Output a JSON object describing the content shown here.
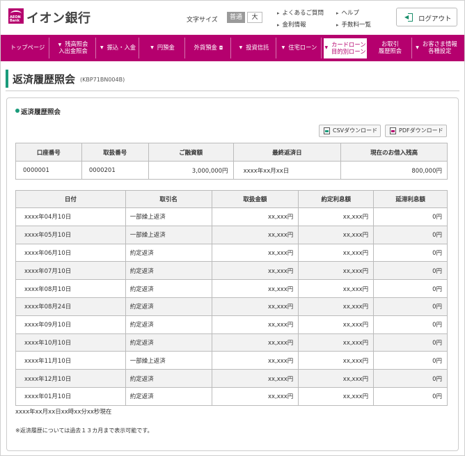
{
  "header": {
    "bank_name": "イオン銀行",
    "logo_small": "AEON Bank",
    "font_size_label": "文字サイズ",
    "font_size_normal": "普通",
    "font_size_large": "大",
    "links": [
      "よくあるご質問",
      "ヘルプ",
      "金利情報",
      "手数料一覧"
    ],
    "logout_label": "ログアウト"
  },
  "nav": {
    "items": [
      {
        "label1": "トップページ",
        "label2": ""
      },
      {
        "label1": "残高照会",
        "label2": "入出金照会"
      },
      {
        "label1": "振込・入金",
        "label2": ""
      },
      {
        "label1": "円預金",
        "label2": ""
      },
      {
        "label1": "外貨預金",
        "label2": ""
      },
      {
        "label1": "投資信託",
        "label2": ""
      },
      {
        "label1": "住宅ローン",
        "label2": ""
      },
      {
        "label1": "カードローン",
        "label2": "目的別ローン"
      },
      {
        "label1": "お取引",
        "label2": "履歴照会"
      },
      {
        "label1": "お客さま情報",
        "label2": "各種設定"
      }
    ],
    "active_index": 7
  },
  "page": {
    "title": "返済履歴照会",
    "code": "(KBP71BN004B)",
    "section_title": "返済履歴照会",
    "csv_button": "CSVダウンロード",
    "pdf_button": "PDFダウンロード"
  },
  "summary": {
    "headers": [
      "口座番号",
      "取扱番号",
      "ご融資額",
      "最終返済日",
      "現在のお借入残高"
    ],
    "row": [
      "0000001",
      "0000201",
      "3,000,000円",
      "xxxx年xx月xx日",
      "800,000円"
    ]
  },
  "history": {
    "headers": [
      "日付",
      "取引名",
      "取扱金額",
      "約定利息額",
      "延滞利息額"
    ],
    "rows": [
      [
        "xxxx年04月10日",
        "一部繰上返済",
        "xx,xxx円",
        "xx,xxx円",
        "0円"
      ],
      [
        "xxxx年05月10日",
        "一部繰上返済",
        "xx,xxx円",
        "xx,xxx円",
        "0円"
      ],
      [
        "xxxx年06月10日",
        "約定返済",
        "xx,xxx円",
        "xx,xxx円",
        "0円"
      ],
      [
        "xxxx年07月10日",
        "約定返済",
        "xx,xxx円",
        "xx,xxx円",
        "0円"
      ],
      [
        "xxxx年08月10日",
        "約定返済",
        "xx,xxx円",
        "xx,xxx円",
        "0円"
      ],
      [
        "xxxx年08月24日",
        "約定返済",
        "xx,xxx円",
        "xx,xxx円",
        "0円"
      ],
      [
        "xxxx年09月10日",
        "約定返済",
        "xx,xxx円",
        "xx,xxx円",
        "0円"
      ],
      [
        "xxxx年10月10日",
        "約定返済",
        "xx,xxx円",
        "xx,xxx円",
        "0円"
      ],
      [
        "xxxx年11月10日",
        "一部繰上返済",
        "xx,xxx円",
        "xx,xxx円",
        "0円"
      ],
      [
        "xxxx年12月10日",
        "約定返済",
        "xx,xxx円",
        "xx,xxx円",
        "0円"
      ],
      [
        "xxxx年01月10日",
        "約定返済",
        "xx,xxx円",
        "xx,xxx円",
        "0円"
      ]
    ]
  },
  "footer": {
    "as_of": "xxxx年xx月xx日xx時xx分xx秒現在",
    "note": "※返済履歴については過去１３カ月まで表示可能です。"
  },
  "colors": {
    "brand": "#b5006e",
    "accent": "#1a9b7b"
  }
}
